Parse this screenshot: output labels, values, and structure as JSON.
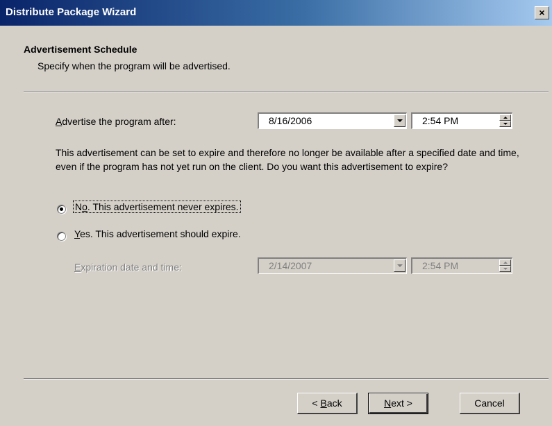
{
  "window": {
    "title": "Distribute Package Wizard",
    "close_glyph": "×"
  },
  "header": {
    "heading": "Advertisement Schedule",
    "subheading": "Specify when the program will be advertised."
  },
  "advertise": {
    "label_prefix": "",
    "label_accel": "A",
    "label_rest": "dvertise the program after:",
    "date": "8/16/2006",
    "time": "2:54 PM"
  },
  "description": "This advertisement can be set to expire and therefore no longer be available after a specified date and time, even if the program has not yet run on the client. Do you want this advertisement to expire?",
  "options": {
    "no": {
      "accel": "o",
      "prefix": "N",
      "rest": ". This advertisement never expires.",
      "checked": true
    },
    "yes": {
      "accel": "Y",
      "prefix": "",
      "rest": "es. This advertisement should expire.",
      "checked": false
    }
  },
  "expiration": {
    "label_prefix": "",
    "label_accel": "E",
    "label_rest": "xpiration date and time:",
    "date": "2/14/2007",
    "time": "2:54 PM"
  },
  "buttons": {
    "back_prefix": "< ",
    "back_accel": "B",
    "back_rest": "ack",
    "next_accel": "N",
    "next_rest": "ext >",
    "cancel": "Cancel"
  },
  "icons": {
    "close": "close-icon",
    "dropdown": "chevron-down-icon",
    "spin_up": "spin-up-icon",
    "spin_down": "spin-down-icon"
  },
  "colors": {
    "title_start": "#0a246a",
    "title_end": "#a6caf0",
    "face": "#d4d0c8",
    "disabled_text": "#808080"
  }
}
